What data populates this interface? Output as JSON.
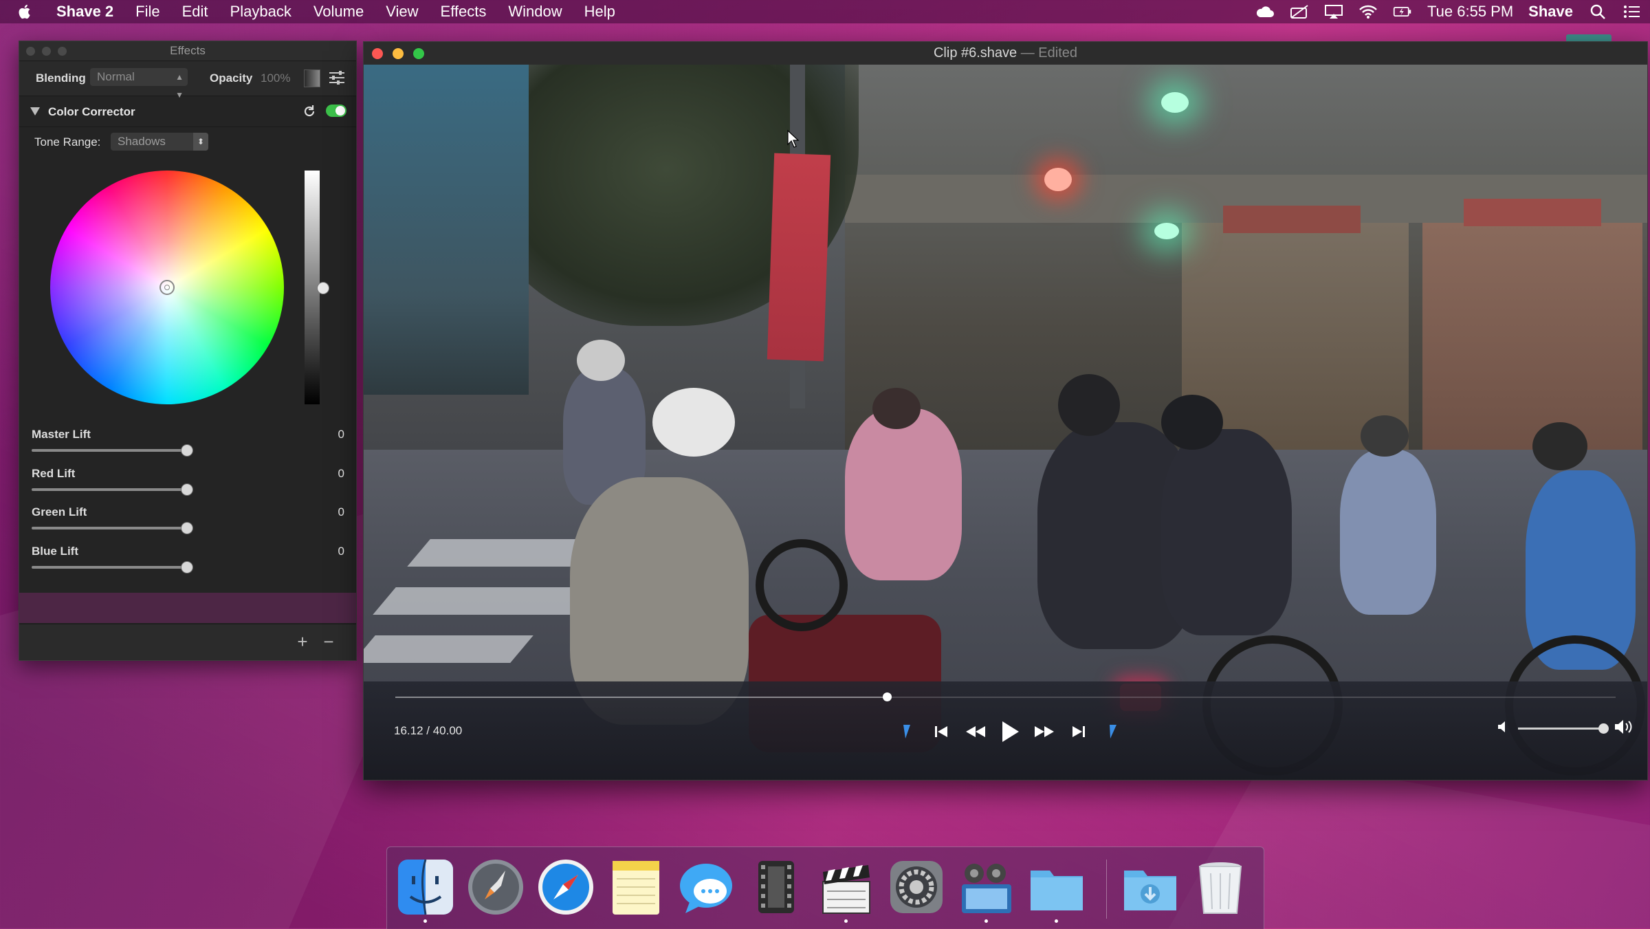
{
  "menubar": {
    "app_name": "Shave 2",
    "menus": [
      "File",
      "Edit",
      "Playback",
      "Volume",
      "View",
      "Effects",
      "Window",
      "Help"
    ],
    "clock": "Tue 6:55 PM",
    "user": "Shave",
    "status_icons": [
      "cloud-icon",
      "camera-off-icon",
      "airplay-icon",
      "wifi-icon",
      "battery-charging-icon"
    ]
  },
  "effects_panel": {
    "title": "Effects",
    "blending_label": "Blending",
    "blending_value": "Normal",
    "opacity_label": "Opacity",
    "opacity_value": "100%",
    "color_corrector": {
      "title": "Color Corrector",
      "enabled": true,
      "tone_range_label": "Tone Range:",
      "tone_range_value": "Shadows",
      "sliders": [
        {
          "label": "Master Lift",
          "value": "0"
        },
        {
          "label": "Red Lift",
          "value": "0"
        },
        {
          "label": "Green Lift",
          "value": "0"
        },
        {
          "label": "Blue Lift",
          "value": "0"
        }
      ]
    },
    "add_label": "+",
    "remove_label": "−"
  },
  "player": {
    "title": "Clip #6.shave",
    "separator": "—",
    "status": "Edited",
    "time_display": "16.12 / 40.00",
    "progress_fraction": 0.403,
    "volume_fraction": 1.0
  },
  "dock": {
    "apps": [
      {
        "name": "finder-icon",
        "running": true
      },
      {
        "name": "launchpad-icon",
        "running": false
      },
      {
        "name": "safari-icon",
        "running": false
      },
      {
        "name": "notes-icon",
        "running": false
      },
      {
        "name": "messages-icon",
        "running": false
      },
      {
        "name": "film-reel-icon",
        "running": false
      },
      {
        "name": "clapperboard-icon",
        "running": true
      },
      {
        "name": "system-preferences-icon",
        "running": false
      },
      {
        "name": "movie-app-icon",
        "running": true
      },
      {
        "name": "folder-icon",
        "running": true
      },
      {
        "name": "downloads-folder-icon",
        "running": false
      },
      {
        "name": "trash-icon",
        "running": false
      }
    ]
  },
  "colors": {
    "toggle_on": "#3cc04a",
    "close": "#fc5753",
    "minimize": "#fdbc40",
    "zoom": "#33c748",
    "marker_blue": "#3a8ee6"
  }
}
